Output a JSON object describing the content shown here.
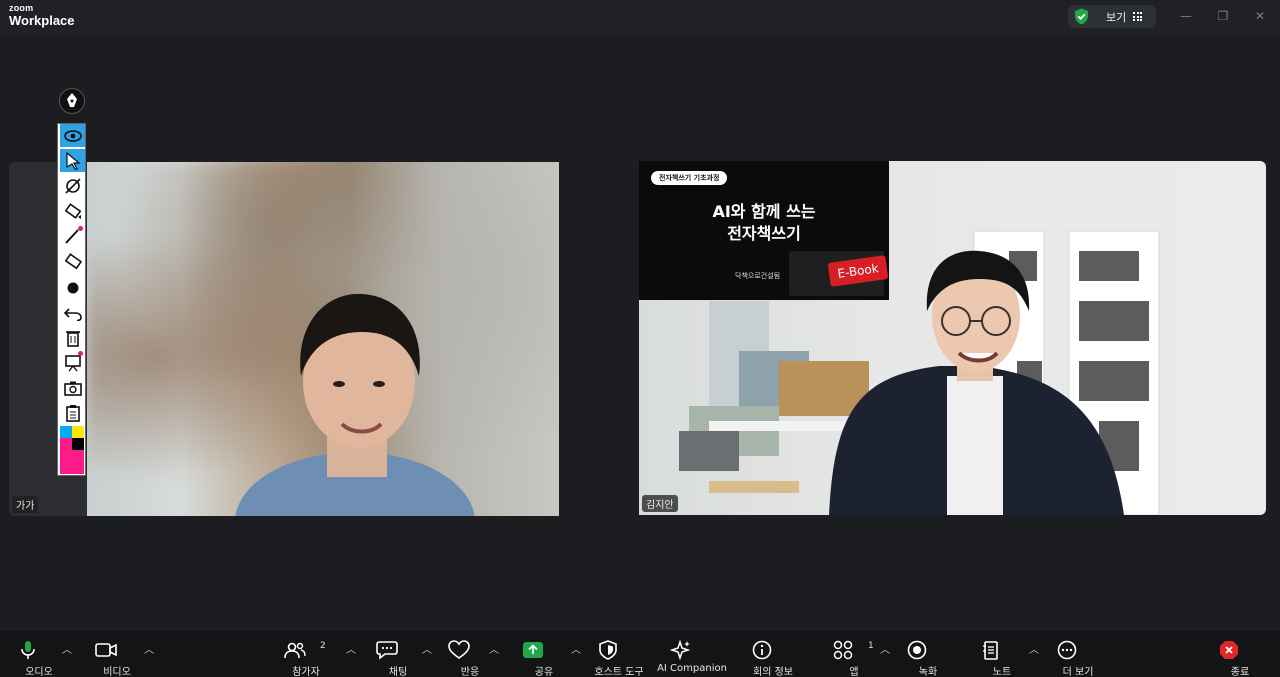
{
  "app": {
    "logo_top": "zoom",
    "logo_bottom": "Workplace",
    "view_label": "보기",
    "minimize": "—",
    "restore": "❐",
    "close": "✕",
    "accent_green": "#21a64b",
    "brand_blue": "#2fa2e4"
  },
  "participants": [
    {
      "name": "가가"
    },
    {
      "name": "김지안"
    }
  ],
  "banner": {
    "badge": "전자책쓰기 기초과정",
    "title_line1": "AI와 함께 쓰는",
    "title_line2": "전자책쓰기",
    "subtitle": "닥책으로건설됨",
    "ebook_key": "E-Book"
  },
  "annotation_tools": [
    {
      "name": "spotlight",
      "icon": "eye-icon"
    },
    {
      "name": "select",
      "icon": "arrow-icon"
    },
    {
      "name": "vanishing-pen",
      "icon": "vanishing-pen-icon"
    },
    {
      "name": "format",
      "icon": "stamp-icon"
    },
    {
      "name": "draw",
      "icon": "line-icon"
    },
    {
      "name": "eraser",
      "icon": "eraser-icon"
    },
    {
      "name": "format-dot",
      "icon": "dot-icon"
    },
    {
      "name": "undo",
      "icon": "undo-icon"
    },
    {
      "name": "clear",
      "icon": "trash-icon"
    },
    {
      "name": "present",
      "icon": "easel-icon"
    },
    {
      "name": "save",
      "icon": "camera-icon"
    },
    {
      "name": "clipboard",
      "icon": "clipboard-icon"
    }
  ],
  "toolbar": {
    "audio": "오디오",
    "video": "비디오",
    "participants": "참가자",
    "participants_count": "2",
    "chat": "채팅",
    "reactions": "반응",
    "share": "공유",
    "host_tools": "호스트 도구",
    "ai_companion": "AI Companion",
    "meeting_info": "회의 정보",
    "apps": "앱",
    "apps_count": "1",
    "record": "녹화",
    "notes": "노트",
    "more": "더 보기",
    "end": "종료"
  }
}
